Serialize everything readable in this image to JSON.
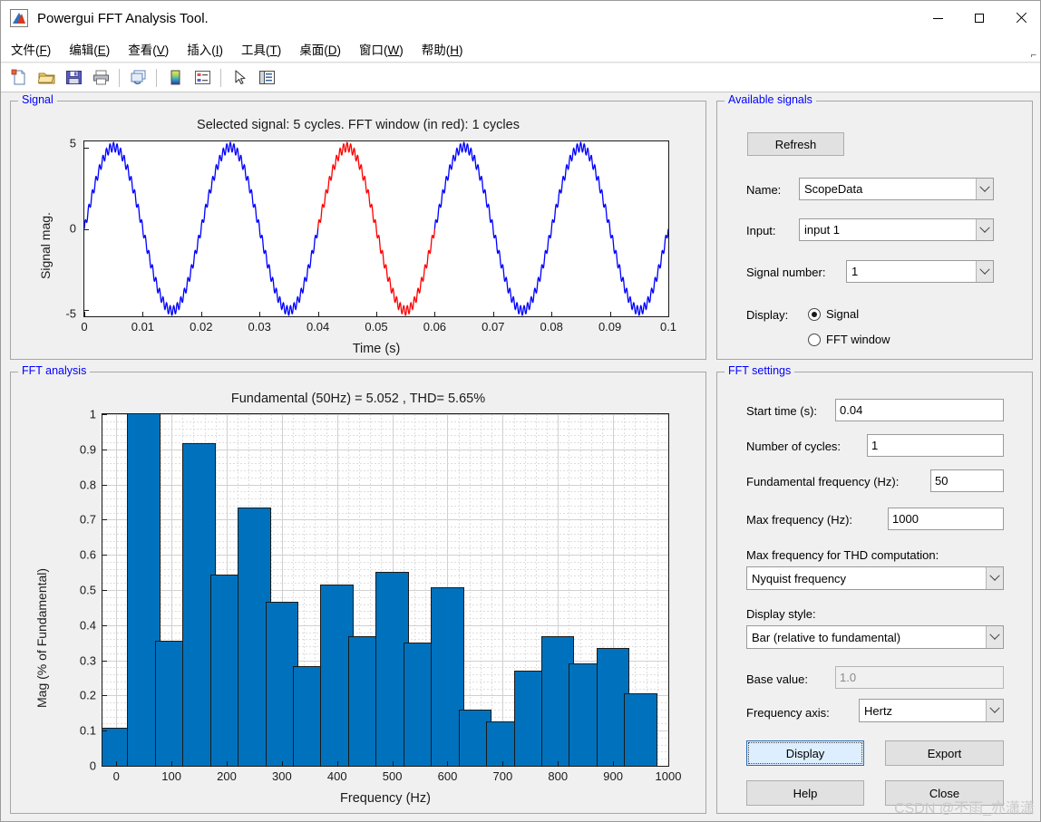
{
  "window": {
    "title": "Powergui FFT Analysis Tool.",
    "icon": "matlab-icon",
    "minimize": "minimize",
    "maximize": "maximize",
    "close": "close"
  },
  "menu": [
    {
      "label": "文件(F)",
      "mnemonic": "F"
    },
    {
      "label": "编辑(E)",
      "mnemonic": "E"
    },
    {
      "label": "查看(V)",
      "mnemonic": "V"
    },
    {
      "label": "插入(I)",
      "mnemonic": "I"
    },
    {
      "label": "工具(T)",
      "mnemonic": "T"
    },
    {
      "label": "桌面(D)",
      "mnemonic": "D"
    },
    {
      "label": "窗口(W)",
      "mnemonic": "W"
    },
    {
      "label": "帮助(H)",
      "mnemonic": "H"
    }
  ],
  "toolbar": [
    {
      "icon": "new-figure-icon"
    },
    {
      "icon": "open-folder-icon"
    },
    {
      "icon": "save-icon"
    },
    {
      "icon": "print-icon"
    },
    {
      "separator": true
    },
    {
      "icon": "link-plot-icon"
    },
    {
      "separator": true
    },
    {
      "icon": "colorbar-icon"
    },
    {
      "icon": "legend-icon"
    },
    {
      "separator": true
    },
    {
      "icon": "pointer-arrow-icon"
    },
    {
      "icon": "plot-browser-icon"
    }
  ],
  "panels": {
    "signal": "Signal",
    "fft_analysis": "FFT analysis",
    "available_signals": "Available signals",
    "fft_settings": "FFT settings"
  },
  "signal_plot": {
    "title": "Selected signal: 5 cycles. FFT window (in red): 1 cycles",
    "xlabel": "Time (s)",
    "ylabel": "Signal mag.",
    "xticks": [
      "0",
      "0.01",
      "0.02",
      "0.03",
      "0.04",
      "0.05",
      "0.06",
      "0.07",
      "0.08",
      "0.09",
      "0.1"
    ],
    "yticks": [
      "5",
      "0",
      "-5"
    ],
    "xlim": [
      0,
      0.1
    ],
    "ylim": [
      -5.4,
      5.4
    ],
    "signal_color": "#0000ff",
    "window_color": "#ff0000",
    "fundamental_hz": 50,
    "amplitude": 5.052,
    "ripple_hz": 1650,
    "ripple_amp": 0.28,
    "window_start": 0.04,
    "window_end": 0.06
  },
  "available_signals": {
    "refresh_label": "Refresh",
    "name_label": "Name:",
    "name_value": "ScopeData",
    "input_label": "Input:",
    "input_value": "input 1",
    "signal_number_label": "Signal number:",
    "signal_number_value": "1",
    "display_label": "Display:",
    "display_options": [
      {
        "label": "Signal",
        "checked": true
      },
      {
        "label": "FFT window",
        "checked": false
      }
    ]
  },
  "fft_settings": {
    "start_time_label": "Start time (s):",
    "start_time_value": "0.04",
    "number_of_cycles_label": "Number of cycles:",
    "number_of_cycles_value": "1",
    "fundamental_frequency_label": "Fundamental frequency (Hz):",
    "fundamental_frequency_value": "50",
    "max_frequency_label": "Max frequency (Hz):",
    "max_frequency_value": "1000",
    "max_freq_thd_label": "Max frequency for THD computation:",
    "max_freq_thd_value": "Nyquist frequency",
    "display_style_label": "Display style:",
    "display_style_value": "Bar (relative to fundamental)",
    "base_value_label": "Base value:",
    "base_value_value": "1.0",
    "frequency_axis_label": "Frequency axis:",
    "frequency_axis_value": "Hertz",
    "display_button": "Display",
    "export_button": "Export",
    "help_button": "Help",
    "close_button": "Close"
  },
  "watermark": "CSDN @不雨_亦潇潇",
  "colors": {
    "panel_title": "#0000ff",
    "bar_fill": "#0072bd",
    "bar_edge": "#1a1a1a",
    "signal_blue": "#0000ff",
    "signal_red": "#ff0000",
    "window_bg": "#f0f0f0",
    "default_button": "#ddeeff"
  },
  "chart_data": {
    "type": "bar",
    "title": "Fundamental (50Hz) = 5.052 , THD= 5.65%",
    "xlabel": "Frequency (Hz)",
    "ylabel": "Mag (% of Fundamental)",
    "xlim": [
      -25,
      1000
    ],
    "ylim": [
      0,
      1
    ],
    "grid": true,
    "legend": null,
    "fundamental_hz": 50,
    "fundamental_value": 5.052,
    "thd_percent": 5.65,
    "xticks": [
      0,
      100,
      200,
      300,
      400,
      500,
      600,
      700,
      800,
      900,
      1000
    ],
    "yticks": [
      0,
      0.1,
      0.2,
      0.3,
      0.4,
      0.5,
      0.6,
      0.7,
      0.8,
      0.9,
      1
    ],
    "x": [
      0,
      50,
      100,
      150,
      200,
      250,
      300,
      350,
      400,
      450,
      500,
      550,
      600,
      650,
      700,
      750,
      800,
      850,
      900,
      950
    ],
    "values": [
      0.106,
      1.0,
      0.352,
      0.916,
      0.542,
      0.731,
      0.463,
      0.281,
      0.513,
      0.366,
      0.548,
      0.347,
      0.506,
      0.156,
      0.124,
      0.268,
      0.366,
      0.288,
      0.332,
      0.203
    ],
    "series": [
      {
        "name": "Mag (% of Fundamental)",
        "values": [
          0.106,
          1.0,
          0.352,
          0.916,
          0.542,
          0.731,
          0.463,
          0.281,
          0.513,
          0.366,
          0.548,
          0.347,
          0.506,
          0.156,
          0.124,
          0.268,
          0.366,
          0.288,
          0.332,
          0.203
        ]
      }
    ]
  }
}
